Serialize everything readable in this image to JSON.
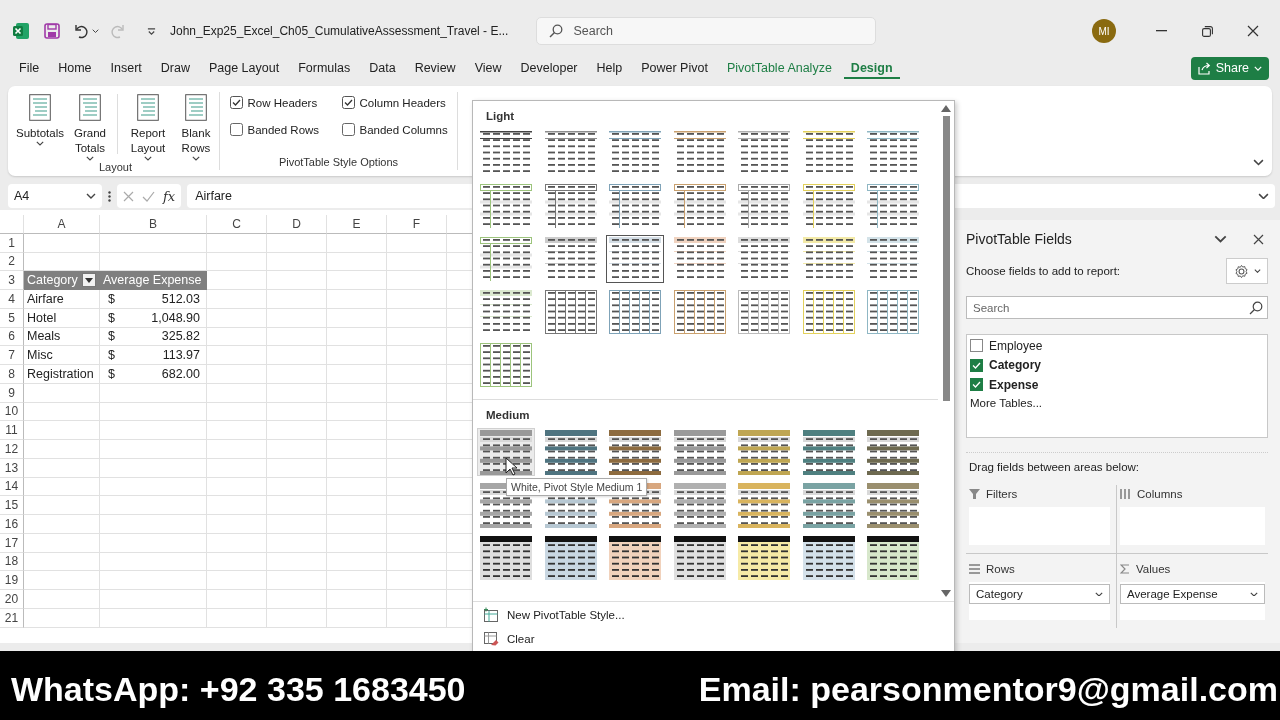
{
  "title_bar": {
    "title": "John_Exp25_Excel_Ch05_CumulativeAssessment_Travel  -  E...",
    "search": {
      "placeholder": "Search"
    },
    "avatar": "MI"
  },
  "ribbon_tabs": [
    {
      "label": "File",
      "kind": "normal",
      "selected": false
    },
    {
      "label": "Home",
      "kind": "normal",
      "selected": false
    },
    {
      "label": "Insert",
      "kind": "normal",
      "selected": false
    },
    {
      "label": "Draw",
      "kind": "normal",
      "selected": false
    },
    {
      "label": "Page Layout",
      "kind": "normal",
      "selected": false
    },
    {
      "label": "Formulas",
      "kind": "normal",
      "selected": false
    },
    {
      "label": "Data",
      "kind": "normal",
      "selected": false
    },
    {
      "label": "Review",
      "kind": "normal",
      "selected": false
    },
    {
      "label": "View",
      "kind": "normal",
      "selected": false
    },
    {
      "label": "Developer",
      "kind": "normal",
      "selected": false
    },
    {
      "label": "Help",
      "kind": "normal",
      "selected": false
    },
    {
      "label": "Power Pivot",
      "kind": "normal",
      "selected": false
    },
    {
      "label": "PivotTable Analyze",
      "kind": "contextual",
      "selected": false
    },
    {
      "label": "Design",
      "kind": "contextual",
      "selected": true
    }
  ],
  "share_button": "Share",
  "ribbon": {
    "layout_buttons": [
      "Subtotals",
      "Grand Totals",
      "Report Layout",
      "Blank Rows"
    ],
    "layout_group_label": "Layout",
    "style_options": [
      {
        "label": "Row Headers",
        "checked": true
      },
      {
        "label": "Column Headers",
        "checked": true
      },
      {
        "label": "Banded Rows",
        "checked": false
      },
      {
        "label": "Banded Columns",
        "checked": false
      }
    ],
    "style_options_group_label": "PivotTable Style Options"
  },
  "formula_bar": {
    "name_box": "A4",
    "function_button": "fx",
    "formula": "Airfare"
  },
  "sheet": {
    "columns": [
      "A",
      "B",
      "C",
      "D",
      "E",
      "F"
    ],
    "rows": [
      {
        "number": "1",
        "kind": "empty"
      },
      {
        "number": "2",
        "kind": "empty"
      },
      {
        "number": "3",
        "kind": "pivot_header",
        "cells": [
          "Category",
          "Average Expense"
        ]
      },
      {
        "number": "4",
        "kind": "pivot_row",
        "cells": [
          "Airfare",
          "$",
          "512.03"
        ]
      },
      {
        "number": "5",
        "kind": "pivot_row",
        "cells": [
          "Hotel",
          "$",
          "1,048.90"
        ]
      },
      {
        "number": "6",
        "kind": "pivot_row",
        "cells": [
          "Meals",
          "$",
          "325.82"
        ]
      },
      {
        "number": "7",
        "kind": "pivot_row",
        "cells": [
          "Misc",
          "$",
          "113.97"
        ]
      },
      {
        "number": "8",
        "kind": "pivot_row",
        "cells": [
          "Registration",
          "$",
          "682.00"
        ]
      },
      {
        "number": "9",
        "kind": "empty"
      },
      {
        "number": "10",
        "kind": "empty"
      },
      {
        "number": "11",
        "kind": "empty"
      },
      {
        "number": "12",
        "kind": "empty"
      },
      {
        "number": "13",
        "kind": "empty"
      },
      {
        "number": "14",
        "kind": "empty"
      },
      {
        "number": "15",
        "kind": "empty"
      },
      {
        "number": "16",
        "kind": "empty"
      },
      {
        "number": "17",
        "kind": "empty"
      },
      {
        "number": "18",
        "kind": "empty"
      },
      {
        "number": "19",
        "kind": "empty"
      },
      {
        "number": "20",
        "kind": "empty"
      },
      {
        "number": "21",
        "kind": "empty"
      }
    ]
  },
  "style_gallery": {
    "sections": [
      {
        "title": "Light",
        "styles": [
          {
            "kind": "lines",
            "color": "#444444",
            "selected": false,
            "hovered": false
          },
          {
            "kind": "lines",
            "color": "#8c8c8c",
            "selected": false,
            "hovered": false
          },
          {
            "kind": "lines",
            "color": "#7fa3b8",
            "selected": false,
            "hovered": false
          },
          {
            "kind": "lines",
            "color": "#c9a06e",
            "selected": false,
            "hovered": false
          },
          {
            "kind": "lines",
            "color": "#b0b0b0",
            "selected": false,
            "hovered": false
          },
          {
            "kind": "lines",
            "color": "#e3d15c",
            "selected": false,
            "hovered": false
          },
          {
            "kind": "lines",
            "color": "#8fb7c4",
            "selected": false,
            "hovered": false
          },
          {
            "kind": "outlined",
            "color": "#9cc47c",
            "selected": false,
            "hovered": false
          },
          {
            "kind": "outlined",
            "color": "#777777",
            "selected": false,
            "hovered": false
          },
          {
            "kind": "outlined",
            "color": "#7fa3b8",
            "selected": false,
            "hovered": false
          },
          {
            "kind": "outlined",
            "color": "#c9a06e",
            "selected": false,
            "hovered": false
          },
          {
            "kind": "outlined",
            "color": "#aaaaaa",
            "selected": false,
            "hovered": false
          },
          {
            "kind": "outlined",
            "color": "#e3d15c",
            "selected": false,
            "hovered": false
          },
          {
            "kind": "outlined",
            "color": "#8fb7c4",
            "selected": false,
            "hovered": false
          },
          {
            "kind": "outlined",
            "color": "#9cc47c",
            "selected": false,
            "hovered": false
          },
          {
            "kind": "banded",
            "color": "#cccccc",
            "selected": false,
            "hovered": false
          },
          {
            "kind": "banded",
            "color": "#d3dde5",
            "selected": true,
            "hovered": false
          },
          {
            "kind": "banded",
            "color": "#f0d3c0",
            "selected": false,
            "hovered": false
          },
          {
            "kind": "banded",
            "color": "#dddddd",
            "selected": false,
            "hovered": false
          },
          {
            "kind": "banded",
            "color": "#f3eaa8",
            "selected": false,
            "hovered": false
          },
          {
            "kind": "banded",
            "color": "#d3e2e8",
            "selected": false,
            "hovered": false
          },
          {
            "kind": "banded",
            "color": "#dbe9cf",
            "selected": false,
            "hovered": false
          },
          {
            "kind": "grid",
            "color": "#777777",
            "selected": false,
            "hovered": false
          },
          {
            "kind": "grid",
            "color": "#7fa3b8",
            "selected": false,
            "hovered": false
          },
          {
            "kind": "grid",
            "color": "#c9a06e",
            "selected": false,
            "hovered": false
          },
          {
            "kind": "grid",
            "color": "#bbbbbb",
            "selected": false,
            "hovered": false
          },
          {
            "kind": "grid",
            "color": "#e3d15c",
            "selected": false,
            "hovered": false
          },
          {
            "kind": "grid",
            "color": "#8fb7c4",
            "selected": false,
            "hovered": false
          },
          {
            "kind": "grid",
            "color": "#9cc47c",
            "selected": false,
            "hovered": false
          }
        ]
      },
      {
        "title": "Medium",
        "styles": [
          {
            "kind": "header",
            "color": "#999999",
            "selected": false,
            "hovered": true
          },
          {
            "kind": "header",
            "color": "#4f7480",
            "selected": false,
            "hovered": false
          },
          {
            "kind": "header",
            "color": "#8d6b3f",
            "selected": false,
            "hovered": false
          },
          {
            "kind": "header",
            "color": "#9a9a9a",
            "selected": false,
            "hovered": false
          },
          {
            "kind": "header",
            "color": "#bfa652",
            "selected": false,
            "hovered": false
          },
          {
            "kind": "header",
            "color": "#4f8080",
            "selected": false,
            "hovered": false
          },
          {
            "kind": "header",
            "color": "#6e6a50",
            "selected": false,
            "hovered": false
          },
          {
            "kind": "header",
            "color": "#a6a6a6",
            "selected": false,
            "hovered": false
          },
          {
            "kind": "header",
            "color": "#b7c8d3",
            "selected": false,
            "hovered": false
          },
          {
            "kind": "header",
            "color": "#d8a77f",
            "selected": false,
            "hovered": false
          },
          {
            "kind": "header",
            "color": "#b0b0b0",
            "selected": false,
            "hovered": false
          },
          {
            "kind": "header",
            "color": "#d9b45e",
            "selected": false,
            "hovered": false
          },
          {
            "kind": "header",
            "color": "#7aa3a3",
            "selected": false,
            "hovered": false
          },
          {
            "kind": "header",
            "color": "#9a8f6e",
            "selected": false,
            "hovered": false
          },
          {
            "kind": "dark",
            "color": "#dedede",
            "selected": false,
            "hovered": false
          },
          {
            "kind": "dark",
            "color": "#c9d7e2",
            "selected": false,
            "hovered": false
          },
          {
            "kind": "dark",
            "color": "#f1d2bc",
            "selected": false,
            "hovered": false
          },
          {
            "kind": "dark",
            "color": "#e0e0e0",
            "selected": false,
            "hovered": false
          },
          {
            "kind": "dark",
            "color": "#f6eaa6",
            "selected": false,
            "hovered": false
          },
          {
            "kind": "dark",
            "color": "#d4e1ea",
            "selected": false,
            "hovered": false
          },
          {
            "kind": "dark",
            "color": "#d7e7cb",
            "selected": false,
            "hovered": false
          }
        ]
      }
    ],
    "tooltip": "White, Pivot Style Medium 1",
    "commands": [
      {
        "kind": "new_style",
        "label": "New PivotTable Style..."
      },
      {
        "kind": "clear",
        "label": "Clear"
      }
    ]
  },
  "field_pane": {
    "title": "PivotTable Fields",
    "instruction": "Choose fields to add to report:",
    "search": {
      "placeholder": "Search"
    },
    "fields": [
      {
        "label": "Employee",
        "checked": false
      },
      {
        "label": "Category",
        "checked": true
      },
      {
        "label": "Expense",
        "checked": true
      }
    ],
    "more_tables": "More Tables...",
    "drag_hint": "Drag fields between areas below:",
    "areas": [
      {
        "kind": "filters",
        "label": "Filters"
      },
      {
        "kind": "columns",
        "label": "Columns"
      },
      {
        "kind": "rows",
        "label": "Rows",
        "items": [
          "Category"
        ]
      },
      {
        "kind": "values",
        "label": "Values",
        "items": [
          "Average Expense"
        ]
      }
    ]
  },
  "banner": {
    "whatsapp": "WhatsApp: +92 335 1683450",
    "email": "Email: pearsonmentor9@gmail.com"
  }
}
